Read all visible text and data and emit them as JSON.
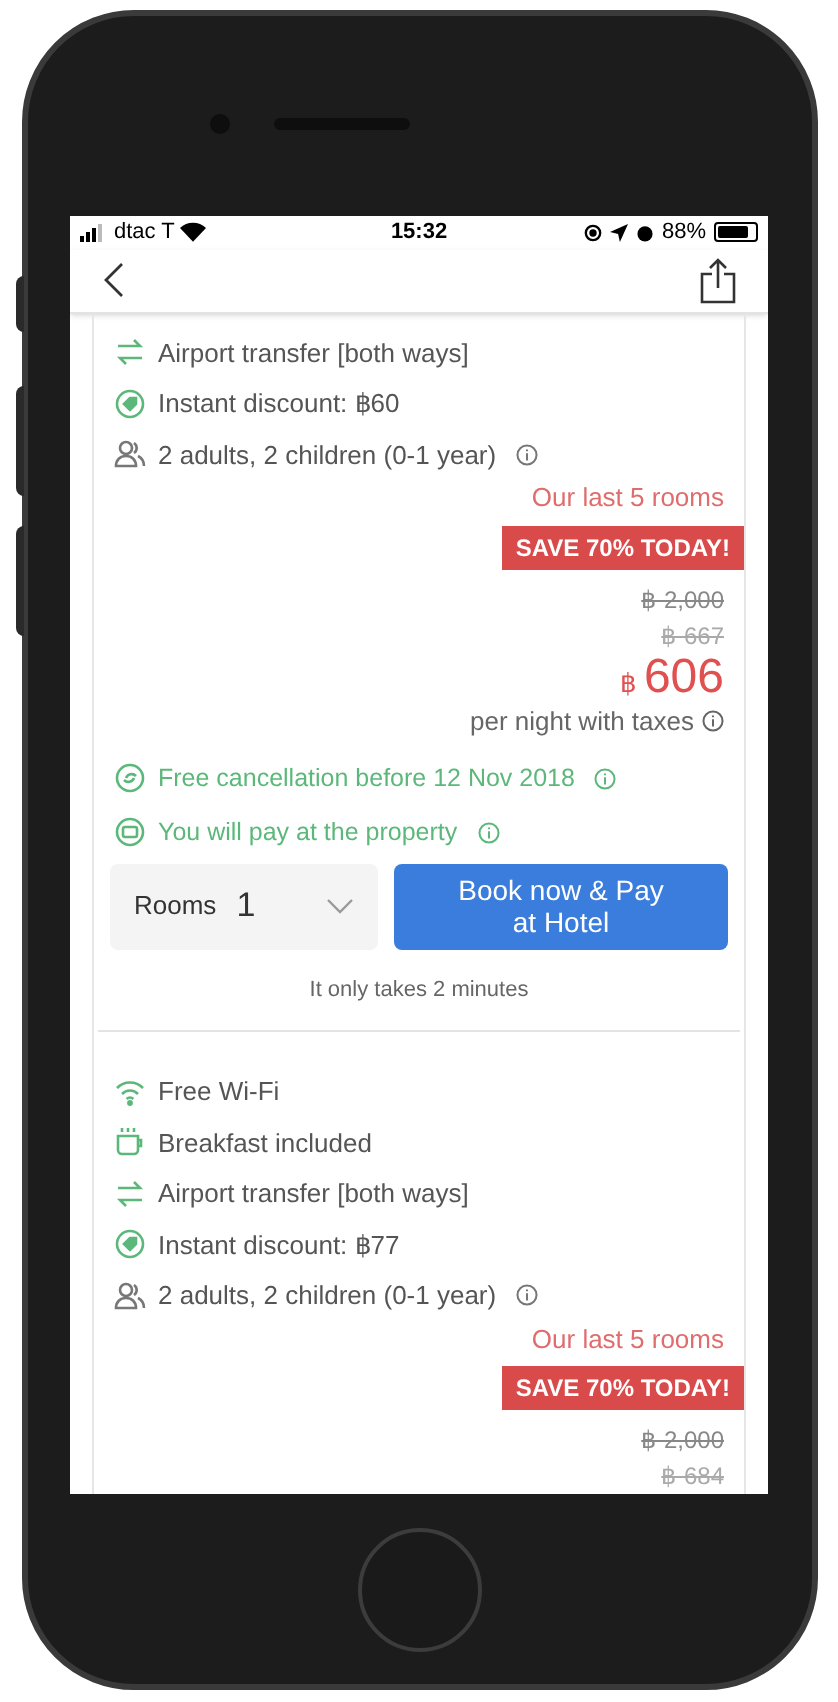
{
  "status_bar": {
    "carrier": "dtac T",
    "time": "15:32",
    "battery": "88%"
  },
  "offers": [
    {
      "amenities": [
        {
          "kind": "transfer",
          "text": "Airport transfer [both ways]",
          "info": false
        },
        {
          "kind": "discount",
          "text": "Instant discount: ฿60",
          "info": false
        },
        {
          "kind": "guests",
          "text": "2 adults, 2 children (0-1 year)",
          "info": true
        }
      ],
      "urgency": "Our last 5 rooms",
      "badge": "SAVE 70% TODAY!",
      "original_price": "฿ 2,000",
      "crossed_price": "฿ 667",
      "currency": "฿",
      "price": "606",
      "price_note": "per night with taxes",
      "policies": [
        {
          "kind": "cancellation",
          "text": "Free cancellation before 12 Nov 2018",
          "info": true
        },
        {
          "kind": "payment",
          "text": "You will pay at the property",
          "info": true
        }
      ],
      "rooms_label": "Rooms",
      "rooms_value": "1",
      "book_button": [
        "Book now & Pay",
        "at Hotel"
      ],
      "note": "It only takes 2 minutes"
    },
    {
      "amenities": [
        {
          "kind": "wifi",
          "text": "Free Wi-Fi",
          "info": false
        },
        {
          "kind": "breakfast",
          "text": "Breakfast included",
          "info": false
        },
        {
          "kind": "transfer",
          "text": "Airport transfer [both ways]",
          "info": false
        },
        {
          "kind": "discount",
          "text": "Instant discount: ฿77",
          "info": false
        },
        {
          "kind": "guests",
          "text": "2 adults, 2 children (0-1 year)",
          "info": true
        }
      ],
      "urgency": "Our last 5 rooms",
      "badge": "SAVE 70% TODAY!",
      "original_price": "฿ 2,000",
      "crossed_price": "฿ 684"
    }
  ]
}
